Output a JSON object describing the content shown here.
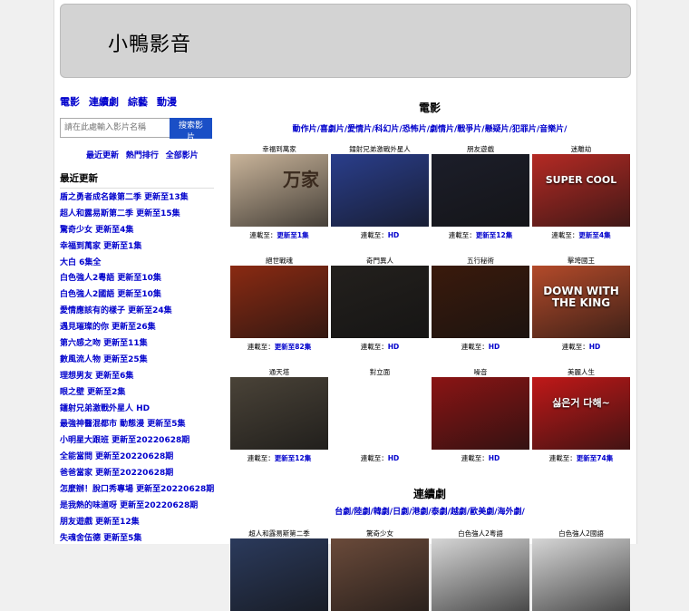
{
  "site": {
    "title": "小鴨影音"
  },
  "sidebar": {
    "categories": [
      "電影",
      "連續劇",
      "綜藝",
      "動漫"
    ],
    "search_placeholder": "請在此處輸入影片名稱",
    "search_button": "搜索影片",
    "quick_links": [
      "最近更新",
      "熱門排行",
      "全部影片"
    ],
    "recent_heading": "最近更新",
    "recent": [
      "盾之勇者成名錄第二季 更新至13集",
      "超人和露易斯第二季 更新至15集",
      "驚奇少女 更新至4集",
      "幸福到萬家 更新至1集",
      "大白 6集全",
      "白色強人2粵語 更新至10集",
      "白色強人2國語 更新至10集",
      "愛情應該有的樣子 更新至24集",
      "遇見璀璨的你 更新至26集",
      "第六感之吻 更新至11集",
      "數風流人物 更新至25集",
      "理想男友 更新至6集",
      "眼之壁 更新至2集",
      "鐳射兄弟激戰外星人 HD",
      "最強神醫混都市 動態漫 更新至5集",
      "小明星大跟班 更新至20220628期",
      "全能當問 更新至20220628期",
      "爸爸當家 更新至20220628期",
      "怎麼辦！脫口秀專場 更新至20220628期",
      "是我熱的味道呀 更新至20220628期",
      "朋友遊戲 更新至12集",
      "失魂舍伍德 更新至5集"
    ]
  },
  "movies": {
    "heading": "電影",
    "genres": "動作片/喜劇片/愛情片/科幻片/恐怖片/劇情片/戰爭片/懸疑片/犯罪片/音樂片/",
    "status_prefix": "連載至：",
    "items": [
      {
        "title": "幸福到萬家",
        "status": "更新至1集"
      },
      {
        "title": "鐳射兄弟激戰外星人",
        "status": "HD"
      },
      {
        "title": "朋友遊戲",
        "status": "更新至12集"
      },
      {
        "title": "迷離劫",
        "status": "更新至4集"
      },
      {
        "title": "絕世戰魂",
        "status": "更新至82集"
      },
      {
        "title": "奇門異人",
        "status": "HD"
      },
      {
        "title": "五行秘術",
        "status": "HD"
      },
      {
        "title": "擊垮國王",
        "status": "HD"
      },
      {
        "title": "通天塔",
        "status": "更新至12集"
      },
      {
        "title": "對立面",
        "status": "HD"
      },
      {
        "title": "噪音",
        "status": "HD"
      },
      {
        "title": "美麗人生",
        "status": "更新至74集"
      }
    ]
  },
  "series": {
    "heading": "連續劇",
    "genres": "台劇/陸劇/韓劇/日劇/港劇/泰劇/越劇/歐美劇/海外劇/",
    "items": [
      {
        "title": "超人和露易斯第二季"
      },
      {
        "title": "驚奇少女"
      },
      {
        "title": "白色強人2粵語"
      },
      {
        "title": "白色強人2國語"
      }
    ]
  },
  "poster_colors": {
    "m0": "#c9b49a",
    "m1": "#2a3e8c",
    "m2": "#1c1e2a",
    "m3": "#b52a24",
    "m4": "#8a2a12",
    "m5": "#23201d",
    "m6": "#3a1a0c",
    "m7": "#b34a2a",
    "m8": "#4a4338",
    "m10": "#8b1414",
    "m11": "#c01818",
    "s0": "#2b3a5c",
    "s1": "#6a4a3a",
    "s2": "#d6d6d6",
    "s3": "#d6d6d6"
  },
  "poster_text": {
    "m0": "万家",
    "m3": "SUPER COOL",
    "m7": "DOWN WITH THE KING",
    "m11": "싫은거 다해~"
  }
}
